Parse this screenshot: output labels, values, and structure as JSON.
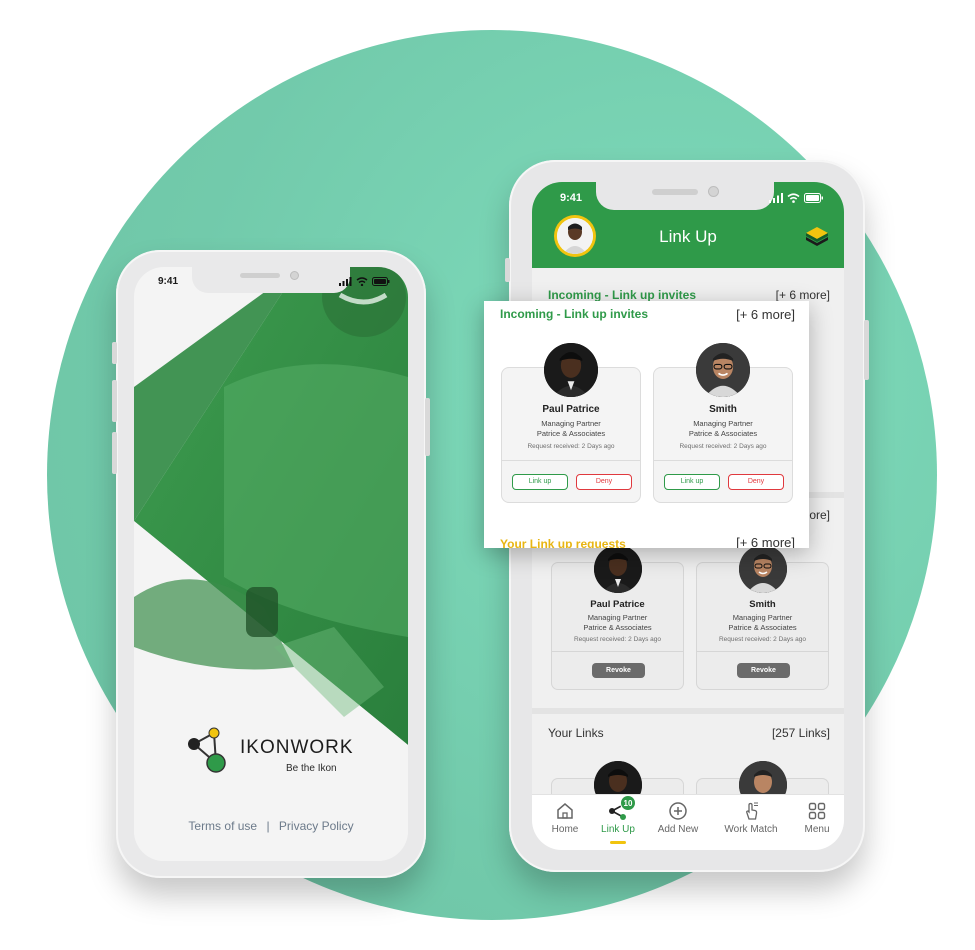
{
  "colors": {
    "brand_green": "#2f9a49",
    "accent_yellow": "#f1c40f",
    "deny_red": "#e0393e",
    "background_circle": "#72caab"
  },
  "left_phone": {
    "status_time": "9:41",
    "brand": {
      "name": "IKONWORK",
      "tagline": "Be the Ikon"
    },
    "footer": {
      "terms": "Terms of use",
      "separator": "|",
      "privacy": "Privacy Policy"
    }
  },
  "right_phone": {
    "status_time": "9:41",
    "header": {
      "title": "Link Up",
      "menu_icon": "layers-icon",
      "avatar_icon": "profile-avatar"
    },
    "incoming": {
      "title": "Incoming - Link up invites",
      "count": "[+ 6 more]",
      "cards": [
        {
          "name": "Paul Patrice",
          "role": "Managing Partner",
          "org": "Patrice & Associates",
          "received": "Request received: 2 Days ago",
          "link_up": "Link up",
          "deny": "Deny"
        },
        {
          "name": "Smith",
          "role": "Managing Partner",
          "org": "Patrice & Associates",
          "received": "Request received: 2 Days ago",
          "link_up": "Link up",
          "deny": "Deny"
        }
      ]
    },
    "your_requests": {
      "title": "Your Link up requests",
      "count": "[+ 6 more]",
      "cards": [
        {
          "name": "Paul Patrice",
          "role": "Managing Partner",
          "org": "Patrice & Associates",
          "received": "Request received: 2 Days ago",
          "action": "Revoke"
        },
        {
          "name": "Smith",
          "role": "Managing Partner",
          "org": "Patrice & Associates",
          "received": "Request received: 2 Days ago",
          "action": "Revoke"
        }
      ]
    },
    "your_links": {
      "title": "Your Links",
      "count": "[257 Links]"
    },
    "nav": [
      {
        "label": "Home",
        "icon": "home-icon"
      },
      {
        "label": "Link Up",
        "icon": "share-icon",
        "badge": "10",
        "active": true
      },
      {
        "label": "Add New",
        "icon": "add-circle-icon"
      },
      {
        "label": "Work Match",
        "icon": "hand-pointer-icon"
      },
      {
        "label": "Menu",
        "icon": "grid-icon"
      }
    ]
  }
}
